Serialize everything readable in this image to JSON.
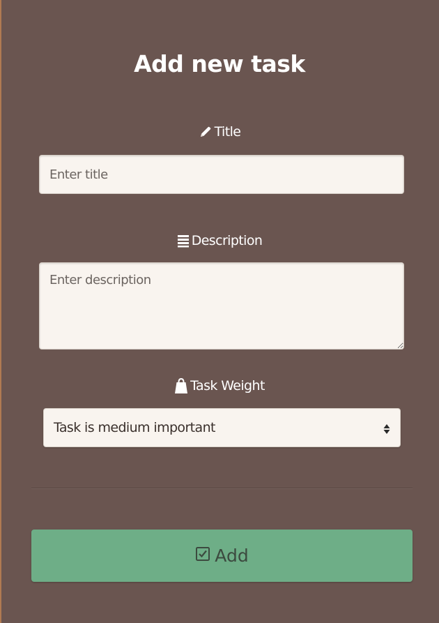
{
  "form": {
    "heading": "Add new task",
    "title_field": {
      "label": "Title",
      "icon": "pencil-icon",
      "placeholder": "Enter title",
      "value": ""
    },
    "description_field": {
      "label": "Description",
      "icon": "list-icon",
      "placeholder": "Enter description",
      "value": ""
    },
    "weight_field": {
      "label": "Task Weight",
      "icon": "weight-icon",
      "selected": "Task is medium important"
    },
    "submit": {
      "label": "Add",
      "icon": "checkbox-checked-icon"
    }
  },
  "colors": {
    "background": "#6a5550",
    "input_background": "#f9f4ef",
    "button": "#6eae87",
    "text_light": "#ffffff"
  }
}
